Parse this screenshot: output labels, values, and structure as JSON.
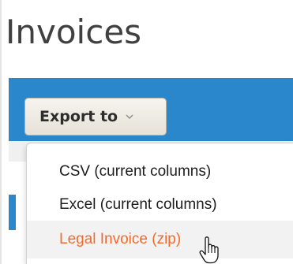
{
  "page": {
    "title": "Invoices"
  },
  "toolbar": {
    "export_label": "Export to",
    "export_chevron_icon": "chevron-down-icon"
  },
  "export_menu": {
    "items": [
      {
        "label": "CSV (current columns)",
        "state": "normal"
      },
      {
        "label": "Excel (current columns)",
        "state": "normal"
      },
      {
        "label": "Legal Invoice (zip)",
        "state": "hovered"
      }
    ]
  },
  "cursor": {
    "icon": "hand-pointer-icon"
  },
  "colors": {
    "toolbar_blue": "#2b87cc",
    "hover_text": "#f26b2d",
    "title_text": "#404040"
  }
}
